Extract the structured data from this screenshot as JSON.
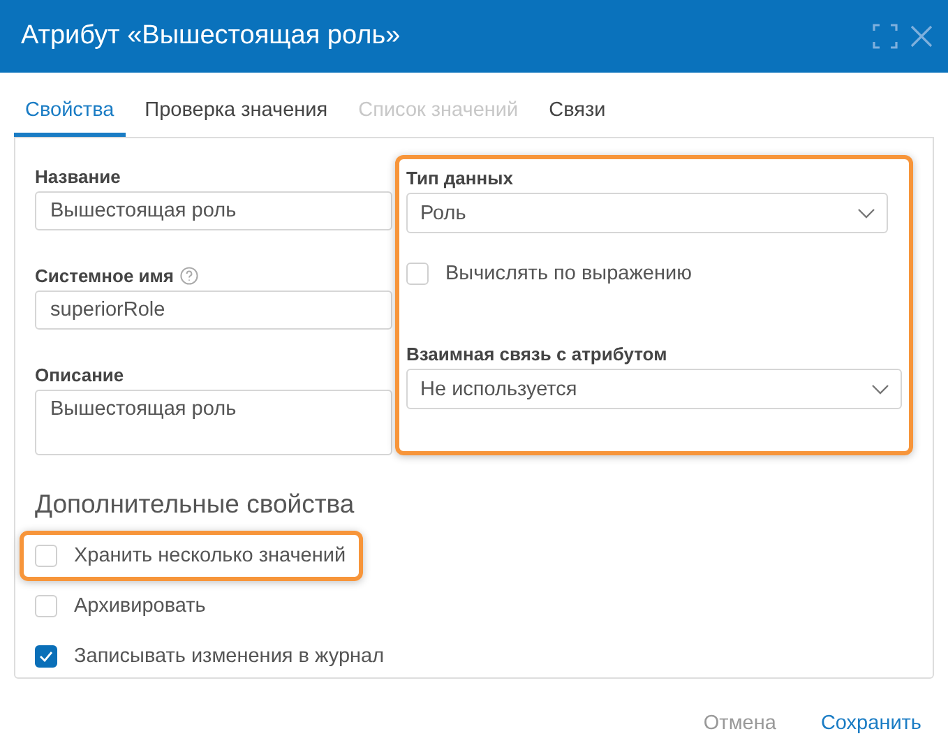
{
  "window": {
    "title": "Атрибут «Вышестоящая роль»"
  },
  "tabs": [
    {
      "label": "Свойства",
      "selected": true,
      "disabled": false
    },
    {
      "label": "Проверка значения",
      "selected": false,
      "disabled": false
    },
    {
      "label": "Список значений",
      "selected": false,
      "disabled": true
    },
    {
      "label": "Связи",
      "selected": false,
      "disabled": false
    }
  ],
  "left_fields": [
    {
      "label": "Название",
      "value": "Вышестоящая роль",
      "kind": "input"
    },
    {
      "label": "Системное имя",
      "value": "superiorRole",
      "kind": "input",
      "help": true
    },
    {
      "label": "Описание",
      "value": "Вышестоящая роль",
      "kind": "textarea"
    }
  ],
  "right_group": {
    "highlighted": true,
    "data_type": {
      "label": "Тип данных",
      "value": "Роль"
    },
    "computed": {
      "label": "Вычислять по выражению",
      "checked": false
    },
    "relation": {
      "label": "Взаимная связь с атрибутом",
      "value": "Не используется"
    }
  },
  "extra": {
    "heading": "Дополнительные свойства",
    "options": [
      {
        "label": "Хранить несколько значений",
        "checked": false,
        "highlighted": true
      },
      {
        "label": "Архивировать",
        "checked": false
      },
      {
        "label": "Записывать изменения в журнал",
        "checked": true
      }
    ]
  },
  "buttons": [
    {
      "label": "Отмена",
      "kind": "secondary"
    },
    {
      "label": "Сохранить",
      "kind": "primary"
    }
  ]
}
